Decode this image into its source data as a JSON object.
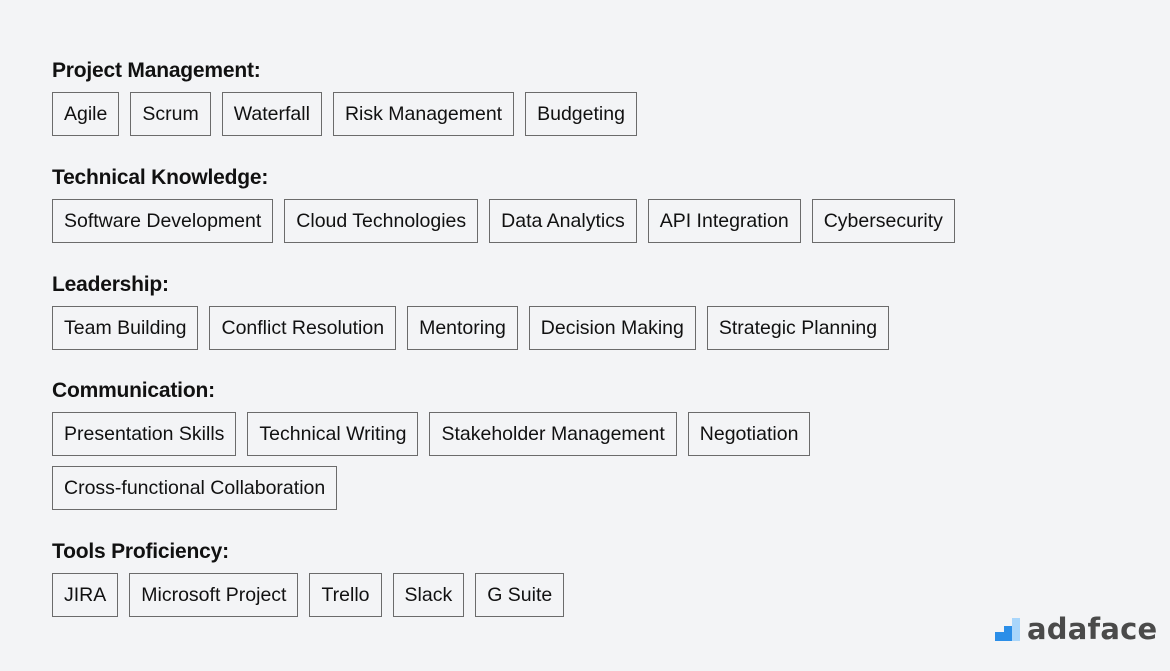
{
  "sections": [
    {
      "title": "Project Management:",
      "tags": [
        "Agile",
        "Scrum",
        "Waterfall",
        "Risk Management",
        "Budgeting"
      ]
    },
    {
      "title": "Technical Knowledge:",
      "tags": [
        "Software Development",
        "Cloud Technologies",
        "Data Analytics",
        "API Integration",
        "Cybersecurity"
      ]
    },
    {
      "title": "Leadership:",
      "tags": [
        "Team Building",
        "Conflict Resolution",
        "Mentoring",
        "Decision Making",
        "Strategic Planning"
      ]
    },
    {
      "title": "Communication:",
      "tags": [
        "Presentation Skills",
        "Technical Writing",
        "Stakeholder Management",
        "Negotiation",
        "Cross-functional Collaboration"
      ]
    },
    {
      "title": "Tools Proficiency:",
      "tags": [
        "JIRA",
        "Microsoft Project",
        "Trello",
        "Slack",
        "G Suite"
      ]
    }
  ],
  "brand": {
    "name": "adaface",
    "icon": "bar-steps-icon",
    "colors": {
      "dark_blue": "#2b8ee8",
      "light_blue": "#a9d6fb",
      "text": "#4a4a4a"
    }
  }
}
